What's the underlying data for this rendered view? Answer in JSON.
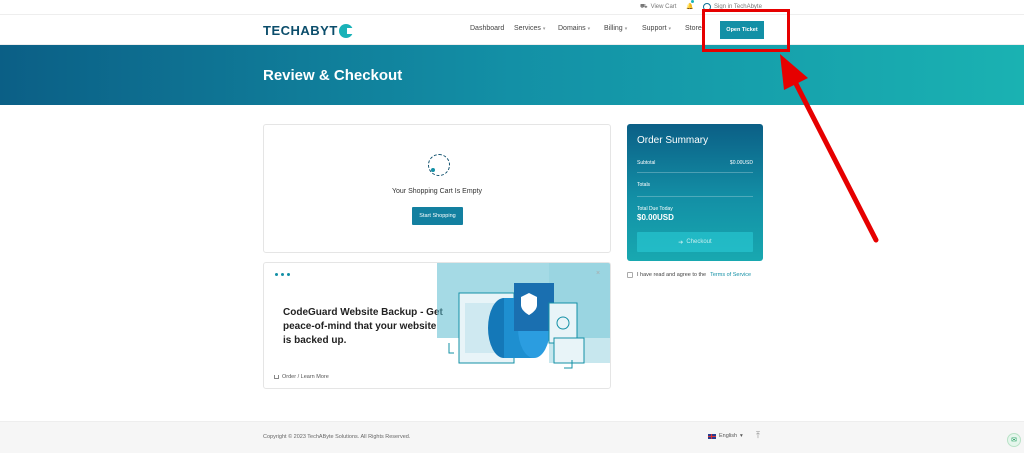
{
  "topbar": {
    "view_cart": "View Cart",
    "language": "Sign in TechAbyte"
  },
  "header": {
    "logo_text": "TECHABYT",
    "nav": [
      {
        "label": "Dashboard",
        "has_caret": false
      },
      {
        "label": "Services",
        "has_caret": true
      },
      {
        "label": "Domains",
        "has_caret": true
      },
      {
        "label": "Billing",
        "has_caret": true
      },
      {
        "label": "Support",
        "has_caret": true
      },
      {
        "label": "Store",
        "has_caret": true
      }
    ],
    "open_ticket": "Open Ticket"
  },
  "banner": {
    "title": "Review & Checkout"
  },
  "cart": {
    "empty_message": "Your Shopping Cart Is Empty",
    "start_shopping": "Start Shopping"
  },
  "promo": {
    "title": "CodeGuard Website Backup - Get peace-of-mind that your website is backed up.",
    "link": "Order / Learn More",
    "close": "×"
  },
  "summary": {
    "title": "Order Summary",
    "subtotal_label": "Subtotal",
    "subtotal_value": "$0.00USD",
    "totals_label": "Totals",
    "due_label": "Total Due Today",
    "due_amount": "$0.00USD",
    "checkout": "Checkout"
  },
  "terms": {
    "text": "I have read and agree to the",
    "link": "Terms of Service"
  },
  "footer": {
    "copyright": "Copyright © 2023 TechAByte Solutions. All Rights Reserved.",
    "language": "English"
  },
  "colors": {
    "brand_dark": "#0b5f86",
    "brand_teal": "#1ab2b2",
    "button": "#1390a6",
    "highlight": "#e60000"
  }
}
